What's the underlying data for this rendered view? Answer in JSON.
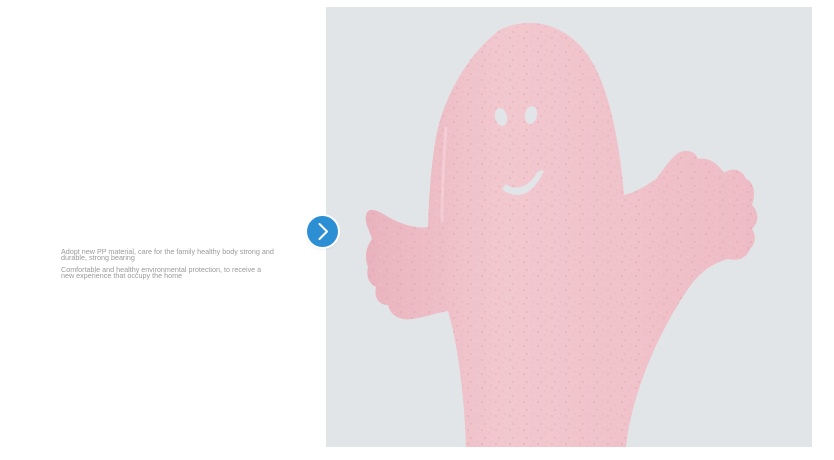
{
  "description": {
    "line1": "Adopt new PP material, care for the family healthy body strong and durable, strong bearing",
    "line2": "Comfortable and healthy environmental protection, to receive a new experience that occupy the home"
  },
  "colors": {
    "photo_background": "#e1e5e8",
    "spoon_pink": "#f0c3cc",
    "button_blue": "#2d8fd3"
  },
  "icons": {
    "next": "chevron-right-icon"
  }
}
